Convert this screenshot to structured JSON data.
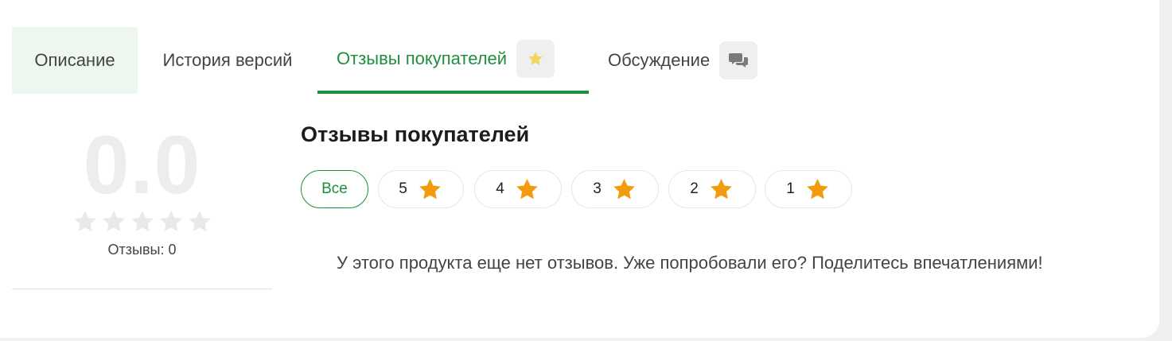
{
  "tabs": {
    "description": "Описание",
    "history": "История версий",
    "reviews": "Отзывы покупателей",
    "discussion": "Обсуждение"
  },
  "summary": {
    "rating": "0.0",
    "stars_filled": 0,
    "stars_total": 5,
    "reviews_label": "Отзывы: 0"
  },
  "reviews": {
    "title": "Отзывы покупателей",
    "filters": [
      {
        "label": "Все"
      },
      {
        "label": "5"
      },
      {
        "label": "4"
      },
      {
        "label": "3"
      },
      {
        "label": "2"
      },
      {
        "label": "1"
      }
    ],
    "empty_message": "У этого продукта еще нет отзывов. Уже попробовали его? Поделитесь впечатлениями!"
  },
  "colors": {
    "accent": "#1a8f3c",
    "star": "#f29b0d",
    "star_empty": "#e9e9e9",
    "badge_star": "#f4d35e",
    "badge_chat": "#7a7a7a"
  },
  "icons": {
    "reviews_tab": "star-icon",
    "discussion_tab": "chat-bubbles-icon",
    "filter_star": "star-icon"
  }
}
